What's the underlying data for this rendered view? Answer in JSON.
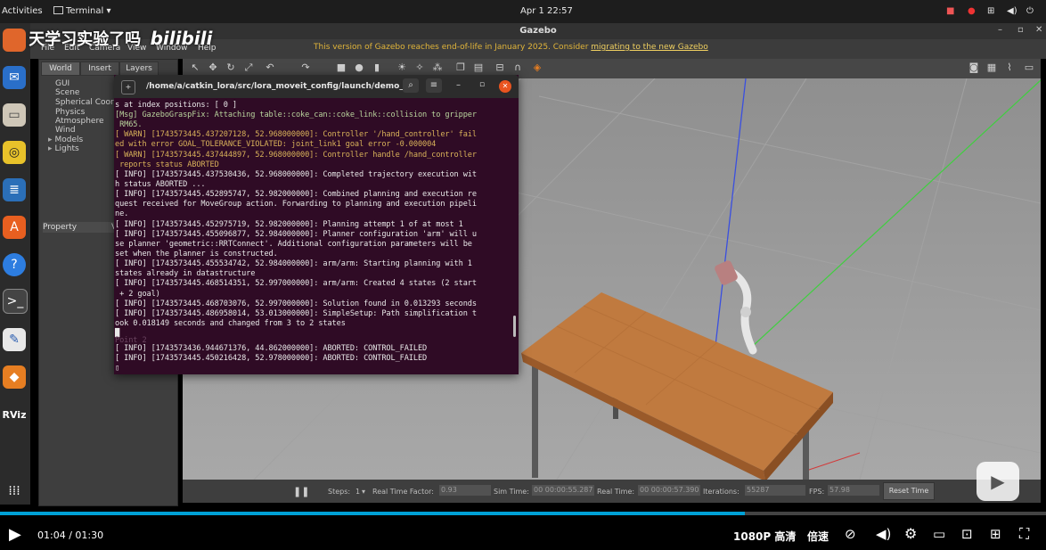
{
  "topbar": {
    "activities": "Activities",
    "app_menu": "Terminal ▾",
    "clock": "Apr 1  22:57"
  },
  "watermark": {
    "text": "天学习实验了吗",
    "logo": "bilibili"
  },
  "gazebo": {
    "title": "Gazebo",
    "eol_warning": "This version of Gazebo reaches end-of-life in January 2025. Consider ",
    "eol_link": "migrating to the new Gazebo",
    "menus": [
      "File",
      "Edit",
      "Camera",
      "View",
      "Window",
      "Help"
    ],
    "tabs": [
      "World",
      "Insert",
      "Layers"
    ],
    "tree": [
      "GUI",
      "Scene",
      "Spherical Coord",
      "Physics",
      "Atmosphere",
      "Wind",
      "Models",
      "Lights"
    ],
    "property_header": "Property",
    "property_value_header": "V",
    "bottom": {
      "steps_label": "Steps:",
      "steps_value": "1",
      "rtf_label": "Real Time Factor:",
      "rtf_value": "0.93",
      "sim_time_label": "Sim Time:",
      "sim_time_value": "00 00:00:55.287",
      "real_time_label": "Real Time:",
      "real_time_value": "00 00:00:57.390",
      "iterations_label": "Iterations:",
      "iterations_value": "55287",
      "fps_label": "FPS:",
      "fps_value": "57.98",
      "reset_time": "Reset Time"
    }
  },
  "terminal": {
    "title": "/home/a/catkin_lora/src/lora_moveit_config/launch/demo_g...",
    "lines": [
      {
        "text": "s at index positions: [ 0 ]",
        "kind": "info"
      },
      {
        "text": "[Msg] GazeboGraspFix: Attaching table::coke_can::coke_link::collision to gripper",
        "kind": "msg"
      },
      {
        "text": " RM65.",
        "kind": "msg"
      },
      {
        "text": "[ WARN] [1743573445.437207128, 52.968000000]: Controller '/hand_controller' fail",
        "kind": "warn"
      },
      {
        "text": "ed with error GOAL_TOLERANCE_VIOLATED: joint_link1 goal error -0.000004",
        "kind": "warn"
      },
      {
        "text": "[ WARN] [1743573445.437444897, 52.968000000]: Controller handle /hand_controller",
        "kind": "warn"
      },
      {
        "text": " reports status ABORTED",
        "kind": "warn"
      },
      {
        "text": "[ INFO] [1743573445.437530436, 52.968000000]: Completed trajectory execution wit",
        "kind": "info"
      },
      {
        "text": "h status ABORTED ...",
        "kind": "info"
      },
      {
        "text": "[ INFO] [1743573445.452895747, 52.982000000]: Combined planning and execution re",
        "kind": "info"
      },
      {
        "text": "quest received for MoveGroup action. Forwarding to planning and execution pipeli",
        "kind": "info"
      },
      {
        "text": "ne.",
        "kind": "info"
      },
      {
        "text": "[ INFO] [1743573445.452975719, 52.982000000]: Planning attempt 1 of at most 1",
        "kind": "info"
      },
      {
        "text": "[ INFO] [1743573445.455096877, 52.984000000]: Planner configuration 'arm' will u",
        "kind": "info"
      },
      {
        "text": "se planner 'geometric::RRTConnect'. Additional configuration parameters will be",
        "kind": "info"
      },
      {
        "text": "set when the planner is constructed.",
        "kind": "info"
      },
      {
        "text": "[ INFO] [1743573445.455534742, 52.984000000]: arm/arm: Starting planning with 1",
        "kind": "info"
      },
      {
        "text": "states already in datastructure",
        "kind": "info"
      },
      {
        "text": "[ INFO] [1743573445.468514351, 52.997000000]: arm/arm: Created 4 states (2 start",
        "kind": "info"
      },
      {
        "text": " + 2 goal)",
        "kind": "info"
      },
      {
        "text": "[ INFO] [1743573445.468703076, 52.997000000]: Solution found in 0.013293 seconds",
        "kind": "info"
      },
      {
        "text": "[ INFO] [1743573445.486958014, 53.013000000]: SimpleSetup: Path simplification t",
        "kind": "info"
      },
      {
        "text": "ook 0.018149 seconds and changed from 3 to 2 states",
        "kind": "info"
      },
      {
        "text": "█",
        "kind": "info"
      },
      {
        "text": "Point 2",
        "kind": "faint"
      },
      {
        "text": "[ INFO] [1743573436.944671376, 44.862000000]: ABORTED: CONTROL_FAILED",
        "kind": "info"
      },
      {
        "text": "[ INFO] [1743573445.450216428, 52.978000000]: ABORTED: CONTROL_FAILED",
        "kind": "info"
      },
      {
        "text": "▯",
        "kind": "info"
      }
    ]
  },
  "player": {
    "current_time": "01:04",
    "total_time": "01:30",
    "time_separator": " / ",
    "quality": "1080P 高清",
    "speed": "倍速",
    "progress": 0.712
  }
}
